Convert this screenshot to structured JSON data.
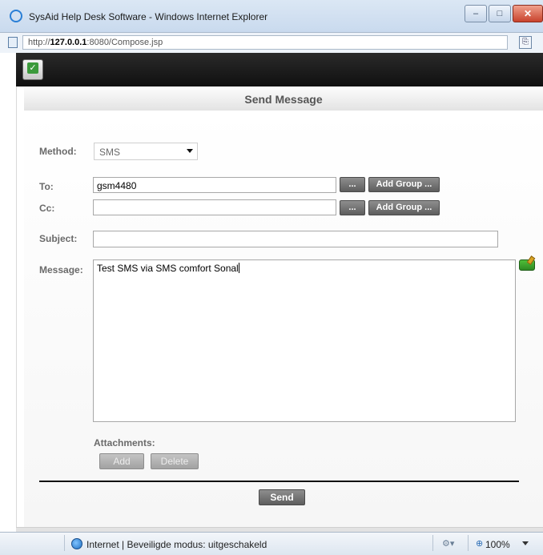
{
  "window": {
    "title": "SysAid Help Desk Software - Windows Internet Explorer",
    "minimize_glyph": "–",
    "maximize_glyph": "□",
    "close_glyph": "✕"
  },
  "address": {
    "prefix": "http://",
    "host": "127.0.0.1",
    "rest": ":8080/Compose.jsp"
  },
  "page": {
    "title": "Send Message"
  },
  "form": {
    "method_label": "Method:",
    "method_value": "SMS",
    "to_label": "To:",
    "to_value": "gsm4480",
    "cc_label": "Cc:",
    "cc_value": "",
    "subject_label": "Subject:",
    "subject_value": "",
    "message_label": "Message:",
    "message_value": "Test SMS via SMS comfort Sonal",
    "browse_label": "...",
    "add_group_label": "Add Group ...",
    "attachments_label": "Attachments:",
    "add_label": "Add",
    "delete_label": "Delete",
    "send_label": "Send"
  },
  "statusbar": {
    "zone_text": "Internet | Beveiligde modus: uitgeschakeld",
    "zoom_text": "100%"
  },
  "icons": {
    "browser": "ie-logo-icon",
    "page": "page-icon",
    "compat": "compatibility-view-icon",
    "app_logo": "sysaid-logo-icon",
    "spellcheck": "spellcheck-icon",
    "globe": "globe-icon",
    "security": "security-icon",
    "zoom": "zoom-icon"
  }
}
